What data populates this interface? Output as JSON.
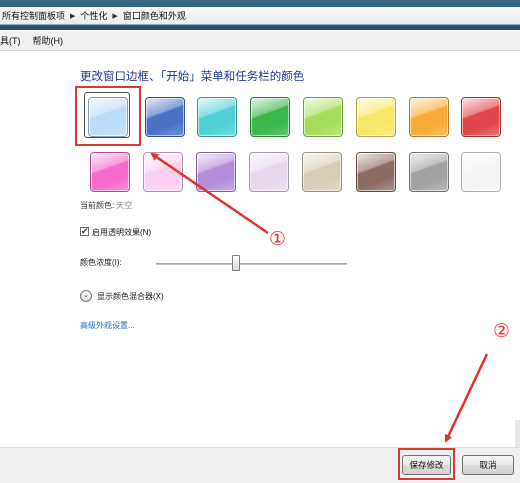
{
  "address_bar": {
    "crumbs": [
      "所有控制面板项",
      "个性化",
      "窗口颜色和外观"
    ]
  },
  "menu": {
    "items": [
      "具(T)",
      "帮助(H)"
    ]
  },
  "page": {
    "title": "更改窗口边框、「开始」菜单和任务栏的颜色",
    "current_color_label": "当前颜色:",
    "current_color_value": "天空",
    "transparency_label": "启用透明效果(N)",
    "transparency_checked": true,
    "intensity_label": "颜色浓度(I):",
    "intensity_value": 0.42,
    "mixer_label": "显示颜色混合器(X)",
    "advanced_link": "高级外观设置..."
  },
  "swatches": [
    {
      "name": "sky",
      "color": "#bcdcf7",
      "selected": true
    },
    {
      "name": "twilight",
      "color": "#4a72c5"
    },
    {
      "name": "sea",
      "color": "#4fd1d3"
    },
    {
      "name": "leaf",
      "color": "#3ab64a"
    },
    {
      "name": "lime",
      "color": "#a6de5c"
    },
    {
      "name": "pumpkin",
      "color": "#f7e869"
    },
    {
      "name": "tangerine",
      "color": "#f9ab38"
    },
    {
      "name": "ruby",
      "color": "#e1474a"
    },
    {
      "name": "fuchsia",
      "color": "#f46bcb"
    },
    {
      "name": "blush",
      "color": "#fbcff0"
    },
    {
      "name": "violet",
      "color": "#b28ed8"
    },
    {
      "name": "lavender",
      "color": "#e6d7ec"
    },
    {
      "name": "taupe",
      "color": "#d6cdb6"
    },
    {
      "name": "chocolate",
      "color": "#8c6d66"
    },
    {
      "name": "slate",
      "color": "#a2a2a2"
    },
    {
      "name": "frost",
      "color": "#f4f4f4"
    }
  ],
  "buttons": {
    "save": "保存修改",
    "cancel": "取消"
  },
  "annotations": [
    "①",
    "②"
  ],
  "colors": {
    "link": "#1f6fc0",
    "title": "#1e3a8a",
    "annotation": "#e2322b"
  }
}
